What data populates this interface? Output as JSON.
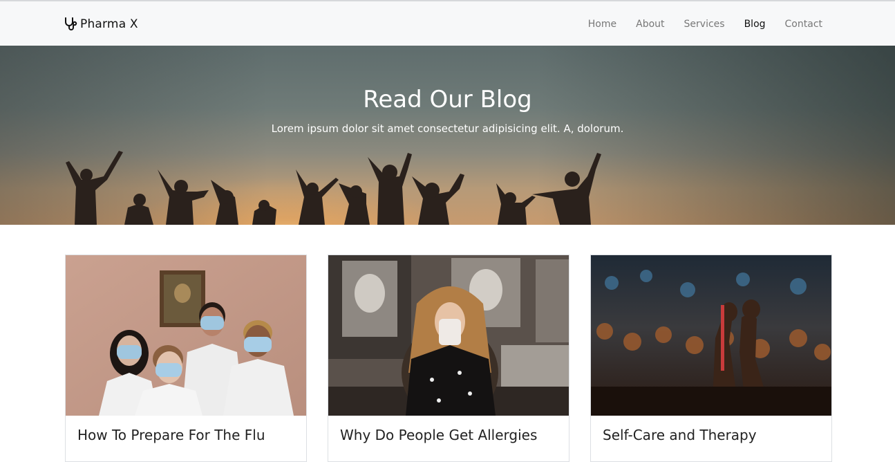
{
  "brand": {
    "name": "Pharma X",
    "icon": "stethoscope-icon"
  },
  "nav": {
    "items": [
      {
        "label": "Home",
        "active": false
      },
      {
        "label": "About",
        "active": false
      },
      {
        "label": "Services",
        "active": false
      },
      {
        "label": "Blog",
        "active": true
      },
      {
        "label": "Contact",
        "active": false
      }
    ]
  },
  "hero": {
    "title": "Read Our Blog",
    "subtitle": "Lorem ipsum dolor sit amet consectetur adipisicing elit. A, dolorum."
  },
  "posts": [
    {
      "title": "How To Prepare For The Flu",
      "image": "people-wearing-face-masks-photo"
    },
    {
      "title": "Why Do People Get Allergies",
      "image": "woman-sneezing-into-tissue-photo"
    },
    {
      "title": "Self-Care and Therapy",
      "image": "crowd-raising-fists-photo"
    }
  ],
  "colors": {
    "navbar_bg": "#f7f8f9",
    "nav_text": "#777777",
    "nav_active": "#111111",
    "hero_text": "#ffffff"
  }
}
